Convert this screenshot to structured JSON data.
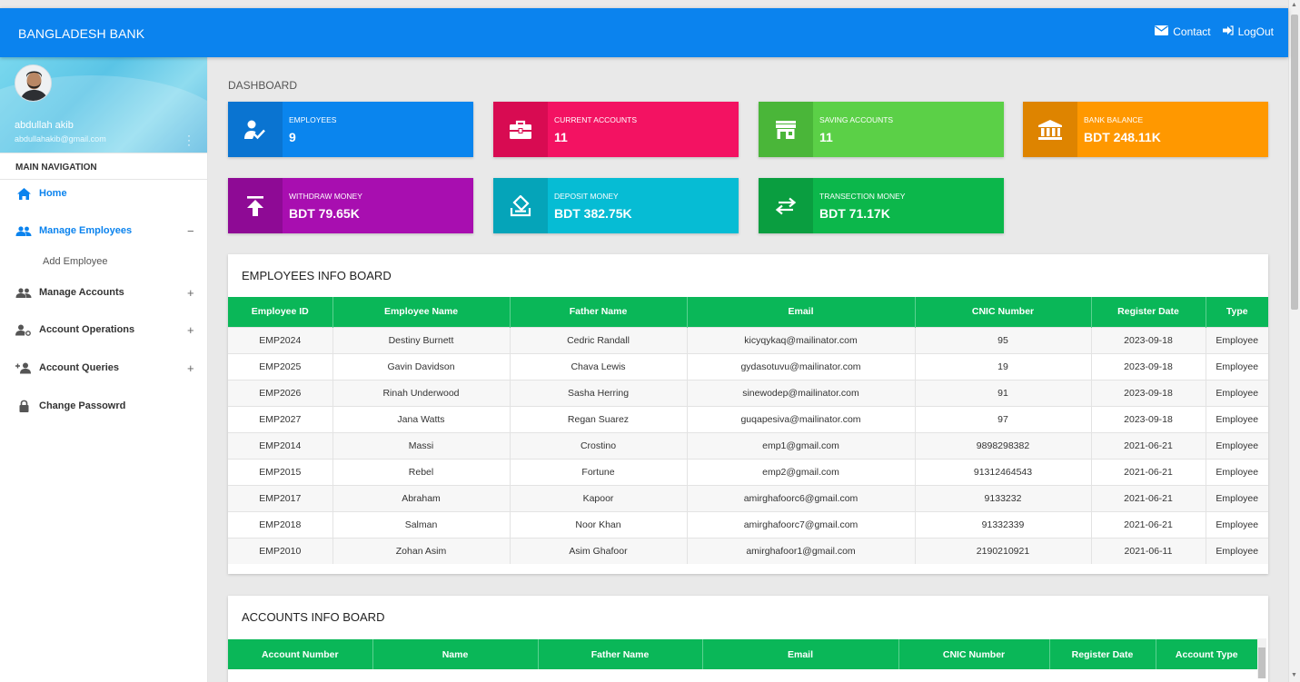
{
  "app": {
    "title": "BANGLADESH BANK"
  },
  "topnav": {
    "contact_label": "Contact",
    "logout_label": "LogOut"
  },
  "user": {
    "name": "abdullah akib",
    "email": "abdullahakib@gmail.com"
  },
  "sidebar": {
    "header": "MAIN NAVIGATION",
    "items": [
      {
        "label": "Home",
        "icon": "home-icon",
        "active": true
      },
      {
        "label": "Manage Employees",
        "icon": "users-icon",
        "active": true,
        "toggle": "−",
        "expanded": true
      },
      {
        "label": "Manage Accounts",
        "icon": "users-icon",
        "toggle": "+"
      },
      {
        "label": "Account Operations",
        "icon": "user-settings-icon",
        "toggle": "+"
      },
      {
        "label": "Account Queries",
        "icon": "user-add-icon",
        "toggle": "+"
      },
      {
        "label": "Change Passowrd",
        "icon": "lock-icon"
      }
    ],
    "subitems": [
      {
        "label": "Add Employee"
      }
    ]
  },
  "page": {
    "title": "DASHBOARD"
  },
  "stats": [
    {
      "label": "EMPLOYEES",
      "value": "9",
      "icon": "person-check-icon",
      "color": "#0a85ee",
      "icon_bg": "#0a74d1"
    },
    {
      "label": "CURRENT ACCOUNTS",
      "value": "11",
      "icon": "briefcase-icon",
      "color": "#f31262",
      "icon_bg": "#d80b52"
    },
    {
      "label": "SAVING ACCOUNTS",
      "value": "11",
      "icon": "store-icon",
      "color": "#5bd047",
      "icon_bg": "#4ab639"
    },
    {
      "label": "BANK BALANCE",
      "value": "BDT 248.11K",
      "icon": "bank-icon",
      "color": "#ff9800",
      "icon_bg": "#de8400"
    },
    {
      "label": "WITHDRAW MONEY",
      "value": "BDT 79.65K",
      "icon": "upload-icon",
      "color": "#a80eb0",
      "icon_bg": "#8e0a95"
    },
    {
      "label": "DEPOSIT MONEY",
      "value": "BDT 382.75K",
      "icon": "deposit-icon",
      "color": "#06bcd4",
      "icon_bg": "#05a4b9"
    },
    {
      "label": "TRANSECTION MONEY",
      "value": "BDT 71.17K",
      "icon": "swap-icon",
      "color": "#0cb74b",
      "icon_bg": "#0a9e40"
    }
  ],
  "employees": {
    "title": "EMPLOYEES INFO BOARD",
    "columns": [
      "Employee ID",
      "Employee Name",
      "Father Name",
      "Email",
      "CNIC Number",
      "Register Date",
      "Type"
    ],
    "rows": [
      [
        "EMP2024",
        "Destiny Burnett",
        "Cedric Randall",
        "kicyqykaq@mailinator.com",
        "95",
        "2023-09-18",
        "Employee"
      ],
      [
        "EMP2025",
        "Gavin Davidson",
        "Chava Lewis",
        "gydasotuvu@mailinator.com",
        "19",
        "2023-09-18",
        "Employee"
      ],
      [
        "EMP2026",
        "Rinah Underwood",
        "Sasha Herring",
        "sinewodep@mailinator.com",
        "91",
        "2023-09-18",
        "Employee"
      ],
      [
        "EMP2027",
        "Jana Watts",
        "Regan Suarez",
        "guqapesiva@mailinator.com",
        "97",
        "2023-09-18",
        "Employee"
      ],
      [
        "EMP2014",
        "Massi",
        "Crostino",
        "emp1@gmail.com",
        "9898298382",
        "2021-06-21",
        "Employee"
      ],
      [
        "EMP2015",
        "Rebel",
        "Fortune",
        "emp2@gmail.com",
        "91312464543",
        "2021-06-21",
        "Employee"
      ],
      [
        "EMP2017",
        "Abraham",
        "Kapoor",
        "amirghafoorc6@gmail.com",
        "9133232",
        "2021-06-21",
        "Employee"
      ],
      [
        "EMP2018",
        "Salman",
        "Noor Khan",
        "amirghafoorc7@gmail.com",
        "91332339",
        "2021-06-21",
        "Employee"
      ],
      [
        "EMP2010",
        "Zohan Asim",
        "Asim Ghafoor",
        "amirghafoor1@gmail.com",
        "2190210921",
        "2021-06-11",
        "Employee"
      ]
    ]
  },
  "accounts": {
    "title": "ACCOUNTS INFO BOARD",
    "columns": [
      "Account Number",
      "Name",
      "Father Name",
      "Email",
      "CNIC Number",
      "Register Date",
      "Account Type"
    ],
    "rows": []
  }
}
